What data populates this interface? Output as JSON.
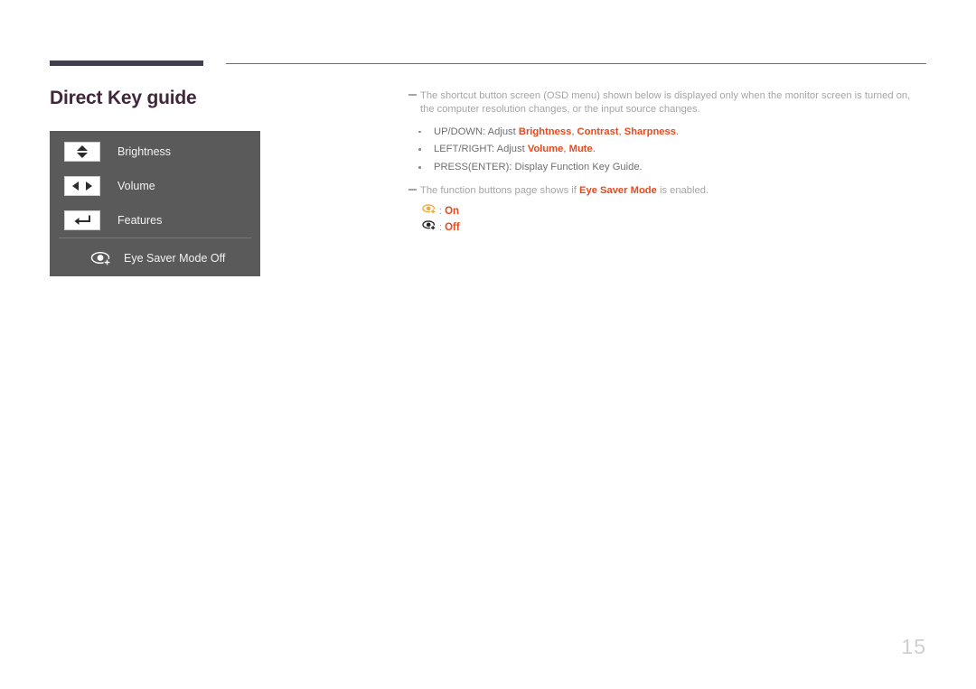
{
  "page": {
    "title": "Direct Key guide",
    "number": "15",
    "accent_bar_color": "#413e50",
    "title_color": "#40273b",
    "highlight_color": "#e8491d"
  },
  "osd": {
    "panel_bg": "#5a5a5a",
    "rows": [
      {
        "key_icon": "up-down-arrows-icon",
        "label": "Brightness"
      },
      {
        "key_icon": "left-right-arrows-icon",
        "label": "Volume"
      },
      {
        "key_icon": "enter-return-arrow-icon",
        "label": "Features"
      }
    ],
    "eye_saver": {
      "icon": "eye-saver-off-icon",
      "label": "Eye Saver Mode Off"
    }
  },
  "notes": {
    "note1": "The shortcut button screen (OSD menu) shown below is displayed only when the monitor screen is turned on, the computer resolution changes, or the input source changes.",
    "bullets": [
      {
        "prefix": "UP/DOWN: Adjust ",
        "terms": [
          "Brightness",
          "Contrast",
          "Sharpness"
        ],
        "suffix": "."
      },
      {
        "prefix": "LEFT/RIGHT: Adjust ",
        "terms": [
          "Volume",
          "Mute"
        ],
        "suffix": "."
      },
      {
        "prefix": "PRESS(ENTER): Display Function Key Guide.",
        "terms": [],
        "suffix": ""
      }
    ],
    "note2_prefix": "The function buttons page shows if ",
    "note2_term": "Eye Saver Mode",
    "note2_suffix": " is enabled.",
    "legend": [
      {
        "icon": "eye-saver-on-icon",
        "separator": ":",
        "value": "On",
        "icon_color": "#f0a93c"
      },
      {
        "icon": "eye-saver-off-icon",
        "separator": ":",
        "value": "Off",
        "icon_color": "#262626"
      }
    ]
  }
}
